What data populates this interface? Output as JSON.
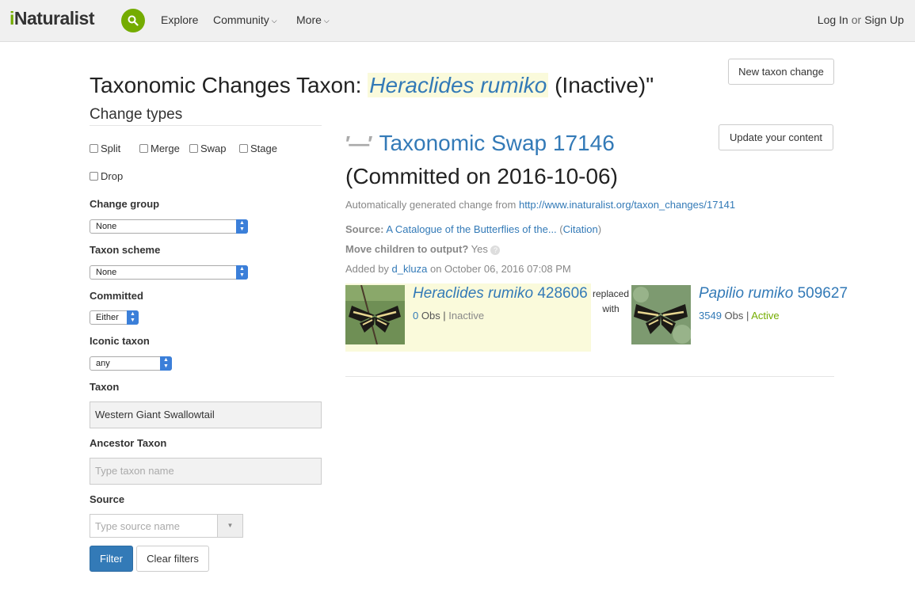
{
  "header": {
    "logo": "Naturalist",
    "logo_i": "i",
    "nav": [
      "Explore",
      "Community",
      "More"
    ],
    "login": "Log In",
    "or": "or",
    "signup": "Sign Up"
  },
  "page": {
    "title_prefix": "Taxonomic Changes Taxon: ",
    "title_taxon": "Heraclides rumiko",
    "title_suffix": " (Inactive)\"",
    "new_taxon_change": "New taxon change"
  },
  "sidebar": {
    "title": "Change types",
    "types": [
      "Split",
      "Merge",
      "Swap",
      "Stage",
      "Drop"
    ],
    "change_group_label": "Change group",
    "change_group_value": "None",
    "taxon_scheme_label": "Taxon scheme",
    "taxon_scheme_value": "None",
    "committed_label": "Committed",
    "committed_value": "Either",
    "iconic_label": "Iconic taxon",
    "iconic_value": "any",
    "taxon_label": "Taxon",
    "taxon_value": "Western Giant Swallowtail",
    "ancestor_label": "Ancestor Taxon",
    "ancestor_placeholder": "Type taxon name",
    "source_label": "Source",
    "source_placeholder": "Type source name",
    "filter": "Filter",
    "clear": "Clear filters"
  },
  "change": {
    "swap_glyph": "′—′",
    "title_link": "Taxonomic Swap 17146",
    "committed": "(Committed on 2016-10-06)",
    "update_button": "Update your content",
    "auto_text": "Automatically generated change from ",
    "auto_link": "http://www.inaturalist.org/taxon_changes/17141",
    "source_label": "Source:",
    "source_link": "A Catalogue of the Butterflies of the...",
    "citation_open": " (",
    "citation": "Citation",
    "citation_close": ")",
    "move_children": "Move children to output?",
    "move_value": " Yes ",
    "added_by": "Added by ",
    "added_user": "d_kluza",
    "added_on": " on October 06, 2016 07:08 PM",
    "replaced": "replaced",
    "with": "with"
  },
  "old_taxon": {
    "name": "Heraclides rumiko",
    "id": " 428606",
    "obs_count": "0",
    "obs_label": " Obs | ",
    "status": "Inactive"
  },
  "new_taxon": {
    "name": "Papilio rumiko",
    "id": " 509627",
    "obs_count": "3549",
    "obs_label": " Obs | ",
    "status": "Active"
  },
  "colors": {
    "brand_green": "#74ac00",
    "link_blue": "#337ab7",
    "highlight": "#fafadb"
  }
}
